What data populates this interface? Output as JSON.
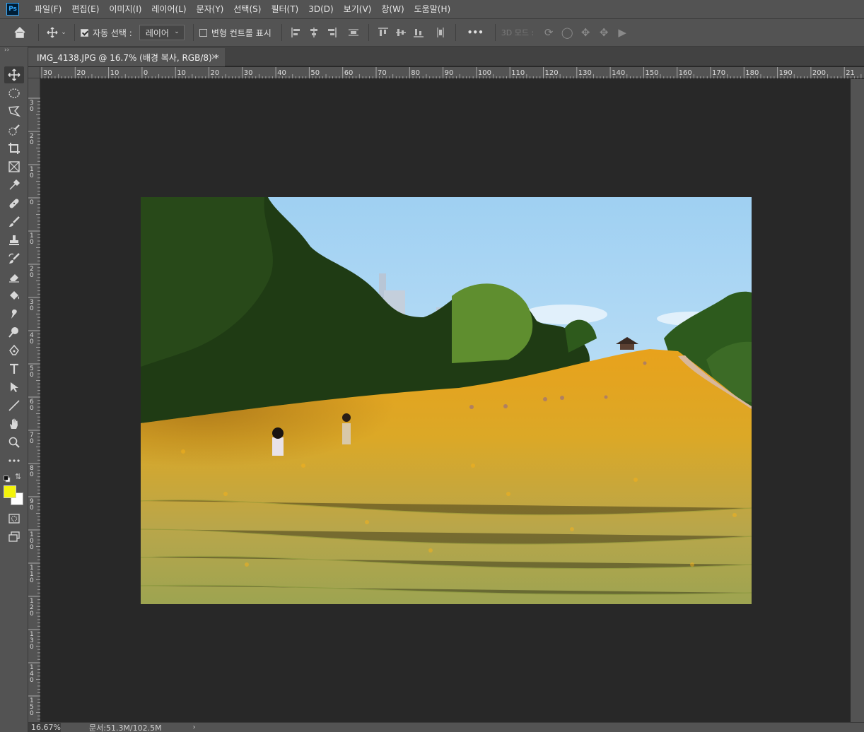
{
  "app": {
    "logo": "Ps"
  },
  "menu": [
    "파일(F)",
    "편집(E)",
    "이미지(I)",
    "레이어(L)",
    "문자(Y)",
    "선택(S)",
    "필터(T)",
    "3D(D)",
    "보기(V)",
    "창(W)",
    "도움말(H)"
  ],
  "options": {
    "auto_select_label": "자동 선택 :",
    "auto_select_checked": true,
    "auto_select_target": "레이어",
    "transform_controls_label": "변형 컨트롤 표시",
    "transform_controls_checked": false,
    "more_label": "•••",
    "mode_3d_label": "3D 모드 :"
  },
  "document": {
    "tab_title": "IMG_4138.JPG @ 16.7% (배경 복사, RGB/8) *",
    "close_glyph": "×"
  },
  "ruler": {
    "h_ticks": [
      "30",
      "20",
      "10",
      "0",
      "10",
      "20",
      "30",
      "40",
      "50",
      "60",
      "70",
      "80",
      "90",
      "100",
      "110",
      "120",
      "130",
      "140",
      "150",
      "160",
      "170",
      "180",
      "190",
      "200",
      "21"
    ],
    "v_ticks": [
      "30",
      "20",
      "10",
      "0",
      "10",
      "20",
      "30",
      "40",
      "50",
      "60",
      "70",
      "80",
      "90",
      "100",
      "110",
      "120",
      "130",
      "140",
      "150"
    ]
  },
  "colors": {
    "foreground": "#f4f40a",
    "background": "#ffffff",
    "panel": "#535353",
    "canvas": "#282828"
  },
  "tools": [
    "move-tool",
    "ellipse-marquee-tool",
    "polygonal-lasso-tool",
    "quick-selection-tool",
    "crop-tool",
    "frame-tool",
    "eyedropper-tool",
    "healing-brush-tool",
    "brush-tool",
    "clone-stamp-tool",
    "history-brush-tool",
    "eraser-tool",
    "paint-bucket-tool",
    "smudge-tool",
    "dodge-tool",
    "pen-tool",
    "type-tool",
    "path-selection-tool",
    "line-tool",
    "hand-tool",
    "zoom-tool",
    "more-tools",
    "quick-mask-mode",
    "screen-mode"
  ],
  "status": {
    "zoom": "16.67%",
    "doc_info": "문서:51.3M/102.5M",
    "arrow": "›"
  }
}
